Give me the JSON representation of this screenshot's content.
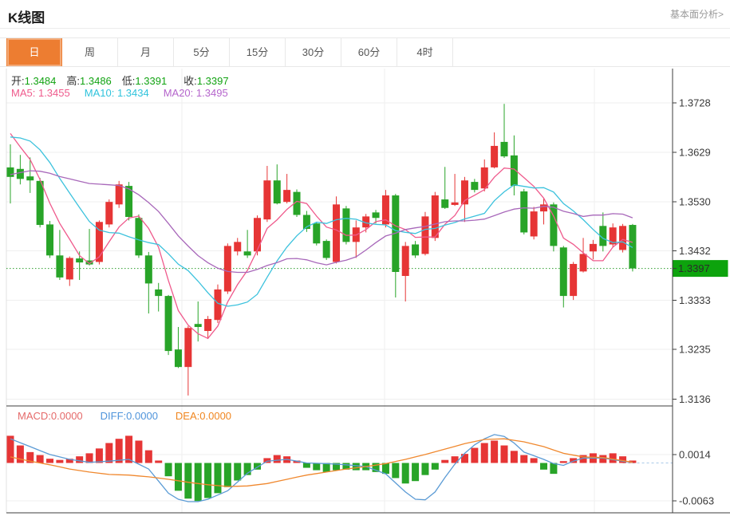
{
  "header": {
    "title": "K线图",
    "link": "基本面分析>"
  },
  "tabs": {
    "items": [
      "日",
      "周",
      "月",
      "5分",
      "15分",
      "30分",
      "60分",
      "4时"
    ],
    "active_index": 0
  },
  "info": {
    "ohlc": {
      "open_label": "开:",
      "open": "1.3484",
      "high_label": "高:",
      "high": "1.3486",
      "low_label": "低:",
      "low": "1.3391",
      "close_label": "收:",
      "close": "1.3397"
    },
    "ma": {
      "ma5_label": "MA5:",
      "ma5": "1.3455",
      "ma10_label": "MA10:",
      "ma10": "1.3434",
      "ma20_label": "MA20:",
      "ma20": "1.3495"
    }
  },
  "macd_info": {
    "macd_label": "MACD:",
    "macd": "0.0000",
    "diff_label": "DIFF:",
    "diff": "0.0000",
    "dea_label": "DEA:",
    "dea": "0.0000"
  },
  "colors": {
    "accent_tab": "#ed7d31",
    "candle_up": "#e63535",
    "candle_down": "#28a428",
    "ma5": "#ef5a8c",
    "ma10": "#3cc2dd",
    "ma20": "#a868ba",
    "diff_line": "#5b9bd5",
    "dea_line": "#f0882e",
    "grid": "#efefef",
    "axis": "#3c3c3c",
    "price_tag_bg": "#0da30d",
    "current_price_line": "#2e9e2e",
    "zero_dash": "#a9c9e9",
    "green_text": "#12a312"
  },
  "chart_data": {
    "type": "candlestick+macd",
    "title": "K线图",
    "legend": [
      "MA5",
      "MA10",
      "MA20",
      "MACD",
      "DIFF",
      "DEA"
    ],
    "grid": true,
    "price_axis_ticks": [
      "1.3728",
      "1.3629",
      "1.3530",
      "1.3432",
      "1.3333",
      "1.3235",
      "1.3136"
    ],
    "price_axis_range": [
      1.3136,
      1.3728
    ],
    "current_price": 1.3397,
    "current_price_tag": "1.3397",
    "macd_axis_ticks": [
      "0.0014",
      "-0.0063"
    ],
    "candles": [
      [
        1.3599,
        1.3645,
        1.3527,
        1.358
      ],
      [
        1.3596,
        1.3624,
        1.3565,
        1.3576
      ],
      [
        1.3581,
        1.3619,
        1.3548,
        1.3573
      ],
      [
        1.3572,
        1.3578,
        1.3479,
        1.3484
      ],
      [
        1.3485,
        1.3492,
        1.3418,
        1.3423
      ],
      [
        1.3423,
        1.3474,
        1.3374,
        1.3379
      ],
      [
        1.3375,
        1.3421,
        1.3362,
        1.3418
      ],
      [
        1.3417,
        1.3431,
        1.3374,
        1.3409
      ],
      [
        1.3413,
        1.3476,
        1.3403,
        1.3405
      ],
      [
        1.341,
        1.3493,
        1.3405,
        1.349
      ],
      [
        1.3485,
        1.3535,
        1.3479,
        1.353
      ],
      [
        1.3525,
        1.3572,
        1.3518,
        1.3565
      ],
      [
        1.3562,
        1.357,
        1.3493,
        1.35
      ],
      [
        1.3498,
        1.3505,
        1.3418,
        1.3423
      ],
      [
        1.3423,
        1.343,
        1.3307,
        1.3367
      ],
      [
        1.3355,
        1.3368,
        1.3311,
        1.3342
      ],
      [
        1.3342,
        1.3344,
        1.3224,
        1.3232
      ],
      [
        1.3235,
        1.328,
        1.3198,
        1.32
      ],
      [
        1.32,
        1.3282,
        1.3143,
        1.3278
      ],
      [
        1.3286,
        1.3331,
        1.3251,
        1.328
      ],
      [
        1.3272,
        1.3302,
        1.3256,
        1.3296
      ],
      [
        1.3294,
        1.3365,
        1.3288,
        1.3355
      ],
      [
        1.3351,
        1.3447,
        1.3346,
        1.3442
      ],
      [
        1.3431,
        1.3458,
        1.3423,
        1.345
      ],
      [
        1.3431,
        1.3474,
        1.3418,
        1.3423
      ],
      [
        1.3431,
        1.3503,
        1.3423,
        1.3498
      ],
      [
        1.3495,
        1.3602,
        1.349,
        1.3573
      ],
      [
        1.3573,
        1.3605,
        1.3525,
        1.3527
      ],
      [
        1.353,
        1.3586,
        1.3527,
        1.3554
      ],
      [
        1.355,
        1.3555,
        1.35,
        1.3504
      ],
      [
        1.3504,
        1.3512,
        1.347,
        1.3476
      ],
      [
        1.3487,
        1.349,
        1.3443,
        1.3447
      ],
      [
        1.3452,
        1.3455,
        1.3414,
        1.3418
      ],
      [
        1.341,
        1.3541,
        1.3407,
        1.3525
      ],
      [
        1.3517,
        1.3522,
        1.3445,
        1.345
      ],
      [
        1.345,
        1.3493,
        1.3418,
        1.3479
      ],
      [
        1.3479,
        1.3506,
        1.3469,
        1.3501
      ],
      [
        1.3509,
        1.3514,
        1.3487,
        1.3498
      ],
      [
        1.3485,
        1.3554,
        1.3479,
        1.3543
      ],
      [
        1.3543,
        1.3546,
        1.3339,
        1.339
      ],
      [
        1.3382,
        1.345,
        1.3331,
        1.3442
      ],
      [
        1.3445,
        1.3452,
        1.3418,
        1.3423
      ],
      [
        1.3426,
        1.351,
        1.3423,
        1.3501
      ],
      [
        1.3458,
        1.355,
        1.3452,
        1.3543
      ],
      [
        1.3535,
        1.36,
        1.3516,
        1.3518
      ],
      [
        1.3524,
        1.3586,
        1.3522,
        1.3529
      ],
      [
        1.3525,
        1.358,
        1.349,
        1.3573
      ],
      [
        1.357,
        1.3576,
        1.3549,
        1.3554
      ],
      [
        1.3557,
        1.3615,
        1.3551,
        1.3599
      ],
      [
        1.3599,
        1.3669,
        1.3597,
        1.3642
      ],
      [
        1.365,
        1.3726,
        1.3618,
        1.3621
      ],
      [
        1.3623,
        1.3663,
        1.3543,
        1.3562
      ],
      [
        1.3551,
        1.3556,
        1.3465,
        1.3469
      ],
      [
        1.3461,
        1.352,
        1.3455,
        1.3511
      ],
      [
        1.3511,
        1.3538,
        1.3485,
        1.3525
      ],
      [
        1.3525,
        1.3529,
        1.3431,
        1.3442
      ],
      [
        1.3439,
        1.3442,
        1.3319,
        1.3342
      ],
      [
        1.3342,
        1.341,
        1.3334,
        1.3406
      ],
      [
        1.3391,
        1.3458,
        1.3389,
        1.3426
      ],
      [
        1.3431,
        1.3454,
        1.3415,
        1.3446
      ],
      [
        1.3482,
        1.3509,
        1.3431,
        1.3442
      ],
      [
        1.3445,
        1.3487,
        1.3439,
        1.3479
      ],
      [
        1.3434,
        1.3486,
        1.3429,
        1.3482
      ],
      [
        1.3484,
        1.3486,
        1.3391,
        1.3397
      ]
    ],
    "pre_closes": [
      1.349,
      1.3494,
      1.3498,
      1.3503,
      1.3507,
      1.351,
      1.3507,
      1.3503,
      1.35,
      1.3515,
      1.3555,
      1.3595,
      1.3635,
      1.3658,
      1.3678,
      1.3698,
      1.371,
      1.37,
      1.3682,
      1.3662
    ],
    "ma_periods": [
      5,
      10,
      20
    ],
    "macd_hist": [
      0.0045,
      0.0029,
      0.0018,
      0.0013,
      0.0007,
      0.0005,
      0.0007,
      0.0011,
      0.0016,
      0.0024,
      0.0033,
      0.004,
      0.0045,
      0.0037,
      0.0021,
      0.0004,
      -0.0022,
      -0.0046,
      -0.0059,
      -0.0063,
      -0.0058,
      -0.005,
      -0.004,
      -0.0029,
      -0.002,
      -0.0011,
      0.0008,
      0.0013,
      0.0011,
      0.0004,
      -0.0008,
      -0.0012,
      -0.0015,
      -0.0012,
      -0.0011,
      -0.0012,
      -0.0012,
      -0.0015,
      -0.0018,
      -0.0025,
      -0.0034,
      -0.003,
      -0.002,
      -0.0011,
      0.0005,
      0.0011,
      0.0015,
      0.0025,
      0.0033,
      0.0037,
      0.0029,
      0.002,
      0.0013,
      0.0008,
      -0.0011,
      -0.0018,
      0.0003,
      0.0008,
      0.0013,
      0.0016,
      0.0013,
      0.0016,
      0.0011,
      0.0004
    ],
    "diff_points": [
      [
        0,
        0.004
      ],
      [
        2,
        0.0027
      ],
      [
        4,
        0.0014
      ],
      [
        6,
        0.0006
      ],
      [
        8,
        0.0001
      ],
      [
        10,
        0.0003
      ],
      [
        12,
        0.0006
      ],
      [
        14,
        -0.001
      ],
      [
        15,
        -0.003
      ],
      [
        16,
        -0.005
      ],
      [
        17,
        -0.006
      ],
      [
        18,
        -0.0064
      ],
      [
        19,
        -0.0064
      ],
      [
        20,
        -0.006
      ],
      [
        22,
        -0.0046
      ],
      [
        24,
        -0.0017
      ],
      [
        26,
        0.0003
      ],
      [
        28,
        0.0006
      ],
      [
        30,
        0.0
      ],
      [
        32,
        -0.0001
      ],
      [
        34,
        -0.0003
      ],
      [
        36,
        -0.0006
      ],
      [
        38,
        -0.0018
      ],
      [
        40,
        -0.0048
      ],
      [
        41,
        -0.006
      ],
      [
        42,
        -0.0061
      ],
      [
        43,
        -0.0048
      ],
      [
        44,
        -0.0024
      ],
      [
        45,
        -0.0002
      ],
      [
        46,
        0.0016
      ],
      [
        47,
        0.003
      ],
      [
        48,
        0.004
      ],
      [
        49,
        0.0047
      ],
      [
        50,
        0.0044
      ],
      [
        51,
        0.0033
      ],
      [
        52,
        0.0018
      ],
      [
        54,
        0.0006
      ],
      [
        55,
        -0.0001
      ],
      [
        56,
        -0.0004
      ],
      [
        57,
        0.0003
      ],
      [
        58,
        0.0008
      ],
      [
        60,
        0.0008
      ],
      [
        62,
        0.0003
      ],
      [
        63,
        0.0001
      ]
    ],
    "dea_points": [
      [
        0,
        0.001
      ],
      [
        2,
        0.0003
      ],
      [
        4,
        -0.0003
      ],
      [
        6,
        -0.001
      ],
      [
        8,
        -0.0015
      ],
      [
        10,
        -0.0019
      ],
      [
        12,
        -0.002
      ],
      [
        14,
        -0.0023
      ],
      [
        16,
        -0.0027
      ],
      [
        18,
        -0.0032
      ],
      [
        20,
        -0.0036
      ],
      [
        22,
        -0.0039
      ],
      [
        24,
        -0.0038
      ],
      [
        26,
        -0.0034
      ],
      [
        28,
        -0.0027
      ],
      [
        30,
        -0.002
      ],
      [
        32,
        -0.0015
      ],
      [
        34,
        -0.001
      ],
      [
        36,
        -0.0006
      ],
      [
        38,
        -0.0001
      ],
      [
        40,
        0.0006
      ],
      [
        42,
        0.0014
      ],
      [
        44,
        0.0023
      ],
      [
        46,
        0.0032
      ],
      [
        48,
        0.0039
      ],
      [
        50,
        0.004
      ],
      [
        52,
        0.0035
      ],
      [
        54,
        0.0027
      ],
      [
        56,
        0.0016
      ],
      [
        58,
        0.001
      ],
      [
        60,
        0.0009
      ],
      [
        62,
        0.0004
      ],
      [
        63,
        0.0001
      ]
    ]
  }
}
